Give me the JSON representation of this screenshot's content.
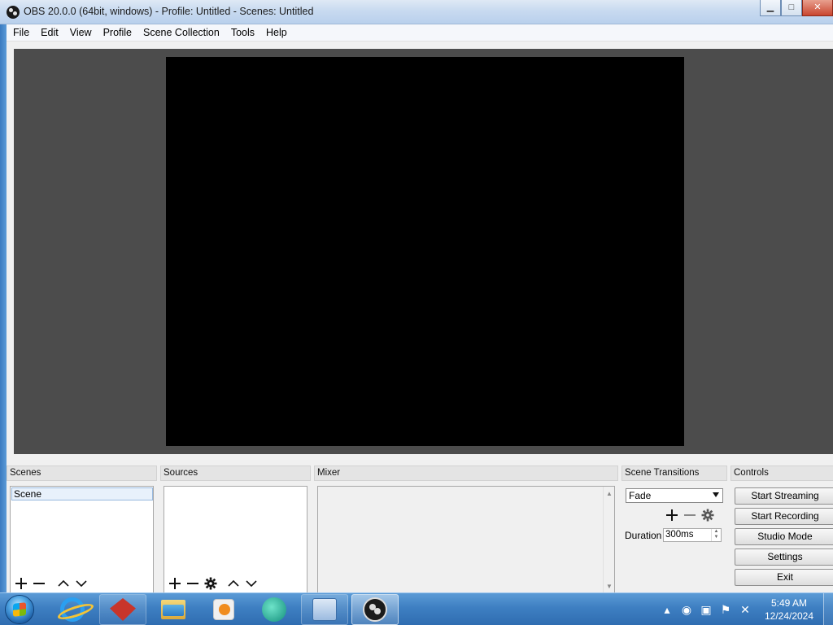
{
  "window": {
    "title": "OBS 20.0.0 (64bit, windows) - Profile: Untitled - Scenes: Untitled",
    "minimize_glyph": "▁",
    "maximize_glyph": "□",
    "close_glyph": "✕"
  },
  "menu": {
    "items": [
      "File",
      "Edit",
      "View",
      "Profile",
      "Scene Collection",
      "Tools",
      "Help"
    ]
  },
  "scenes": {
    "title": "Scenes",
    "items": [
      "Scene"
    ]
  },
  "sources": {
    "title": "Sources"
  },
  "mixer": {
    "title": "Mixer"
  },
  "scene_transitions": {
    "title": "Scene Transitions",
    "selected": "Fade",
    "duration_label": "Duration",
    "duration_value": "300ms"
  },
  "controls": {
    "title": "Controls",
    "buttons": [
      "Start Streaming",
      "Start Recording",
      "Studio Mode",
      "Settings",
      "Exit"
    ]
  },
  "taskbar": {
    "time": "5:49 AM",
    "date": "12/24/2024"
  },
  "icons": {
    "add": "add-icon",
    "remove": "remove-icon",
    "move_up": "chevron-up-icon",
    "move_down": "chevron-down-icon",
    "properties": "gear-icon"
  }
}
